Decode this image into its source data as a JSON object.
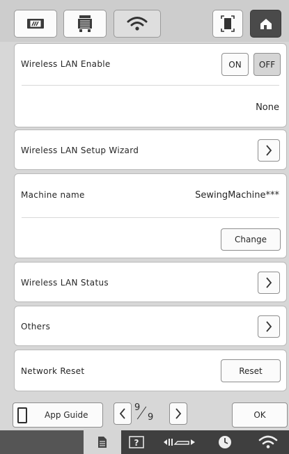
{
  "tabs": [
    {
      "icon": "embroidery-frame-icon"
    },
    {
      "icon": "machine-settings-icon"
    },
    {
      "icon": "wifi-icon",
      "active": true
    },
    {
      "icon": "screen-capture-icon"
    },
    {
      "icon": "home-icon"
    }
  ],
  "wireless_lan": {
    "label": "Wireless LAN Enable",
    "on_label": "ON",
    "off_label": "OFF",
    "selected": "OFF",
    "network_value": "None"
  },
  "setup_wizard": {
    "label": "Wireless LAN Setup Wizard"
  },
  "machine_name": {
    "label": "Machine name",
    "value": "SewingMachine***",
    "change_label": "Change"
  },
  "lan_status": {
    "label": "Wireless LAN Status"
  },
  "others": {
    "label": "Others"
  },
  "network_reset": {
    "label": "Network Reset",
    "reset_label": "Reset"
  },
  "footer": {
    "app_guide_label": "App Guide",
    "page_current": "9",
    "page_total": "9",
    "ok_label": "OK"
  },
  "statusbar": {
    "icons": [
      "document-icon",
      "help-icon",
      "needle-position-icon",
      "clock-icon",
      "wifi-status-icon"
    ]
  }
}
